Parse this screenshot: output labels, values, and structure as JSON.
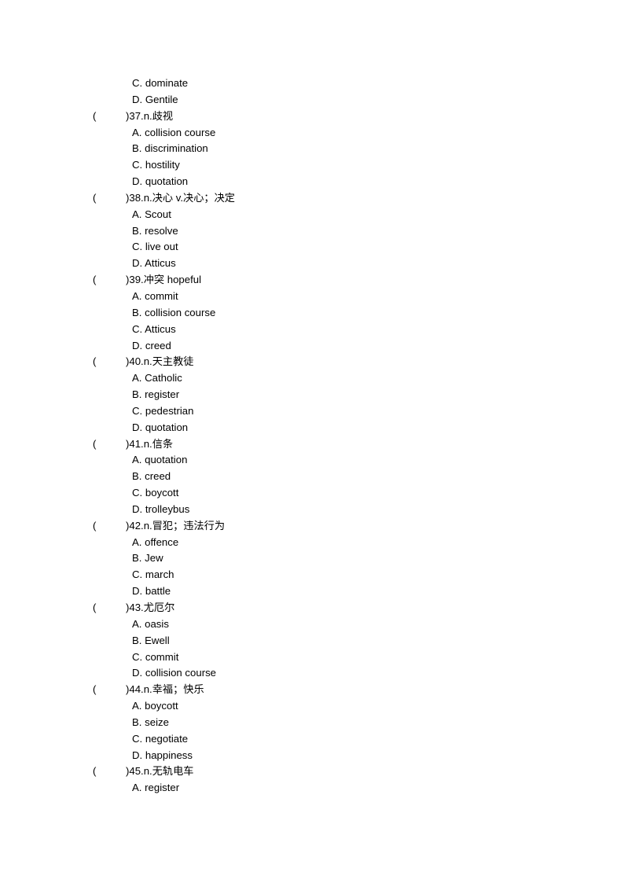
{
  "document": {
    "page_background": "#ffffff",
    "text_color": "#000000",
    "orphan_options": [
      {
        "label": "C.",
        "text": "dominate"
      },
      {
        "label": "D.",
        "text": "Gentile"
      }
    ],
    "questions": [
      {
        "paren_open": "(",
        "paren_close": ")",
        "number": "37.",
        "pos": "n.",
        "prompt": "歧视",
        "stem": ")37.n.歧视",
        "options": [
          {
            "label": "A.",
            "text": "collision course"
          },
          {
            "label": "B.",
            "text": "discrimination"
          },
          {
            "label": "C.",
            "text": "hostility"
          },
          {
            "label": "D.",
            "text": "quotation"
          }
        ]
      },
      {
        "paren_open": "(",
        "paren_close": ")",
        "number": "38.",
        "pos": "n.",
        "prompt": "决心 v.决心；决定",
        "stem": ")38.n.决心 v.决心；决定",
        "options": [
          {
            "label": "A.",
            "text": "Scout"
          },
          {
            "label": "B.",
            "text": "resolve"
          },
          {
            "label": "C.",
            "text": "live out"
          },
          {
            "label": "D.",
            "text": "Atticus"
          }
        ]
      },
      {
        "paren_open": "(",
        "paren_close": ")",
        "number": "39.",
        "pos": "",
        "prompt": "冲突 hopeful",
        "stem": ")39.冲突 hopeful",
        "options": [
          {
            "label": "A.",
            "text": "commit"
          },
          {
            "label": "B.",
            "text": "collision course"
          },
          {
            "label": "C.",
            "text": "Atticus"
          },
          {
            "label": "D.",
            "text": "creed"
          }
        ]
      },
      {
        "paren_open": "(",
        "paren_close": ")",
        "number": "40.",
        "pos": "n.",
        "prompt": "天主教徒",
        "stem": ")40.n.天主教徒",
        "options": [
          {
            "label": "A.",
            "text": "Catholic"
          },
          {
            "label": "B.",
            "text": "register"
          },
          {
            "label": "C.",
            "text": "pedestrian"
          },
          {
            "label": "D.",
            "text": "quotation"
          }
        ]
      },
      {
        "paren_open": "(",
        "paren_close": ")",
        "number": "41.",
        "pos": "n.",
        "prompt": "信条",
        "stem": ")41.n.信条",
        "options": [
          {
            "label": "A.",
            "text": "quotation"
          },
          {
            "label": "B.",
            "text": "creed"
          },
          {
            "label": "C.",
            "text": "boycott"
          },
          {
            "label": "D.",
            "text": "trolleybus"
          }
        ]
      },
      {
        "paren_open": "(",
        "paren_close": ")",
        "number": "42.",
        "pos": "n.",
        "prompt": "冒犯；违法行为",
        "stem": ")42.n.冒犯；违法行为",
        "options": [
          {
            "label": "A.",
            "text": "offence"
          },
          {
            "label": "B.",
            "text": "Jew"
          },
          {
            "label": "C.",
            "text": "march"
          },
          {
            "label": "D.",
            "text": "battle"
          }
        ]
      },
      {
        "paren_open": "(",
        "paren_close": ")",
        "number": "43.",
        "pos": "",
        "prompt": "尤厄尔",
        "stem": ")43.尤厄尔",
        "options": [
          {
            "label": "A.",
            "text": "oasis"
          },
          {
            "label": "B.",
            "text": "Ewell"
          },
          {
            "label": "C.",
            "text": "commit"
          },
          {
            "label": "D.",
            "text": "collision course"
          }
        ]
      },
      {
        "paren_open": "(",
        "paren_close": ")",
        "number": "44.",
        "pos": "n.",
        "prompt": "幸福；快乐",
        "stem": ")44.n.幸福；快乐",
        "options": [
          {
            "label": "A.",
            "text": "boycott"
          },
          {
            "label": "B.",
            "text": "seize"
          },
          {
            "label": "C.",
            "text": "negotiate"
          },
          {
            "label": "D.",
            "text": "happiness"
          }
        ]
      },
      {
        "paren_open": "(",
        "paren_close": ")",
        "number": "45.",
        "pos": "n.",
        "prompt": "无轨电车",
        "stem": ")45.n.无轨电车",
        "options": [
          {
            "label": "A.",
            "text": "register"
          }
        ]
      }
    ]
  }
}
